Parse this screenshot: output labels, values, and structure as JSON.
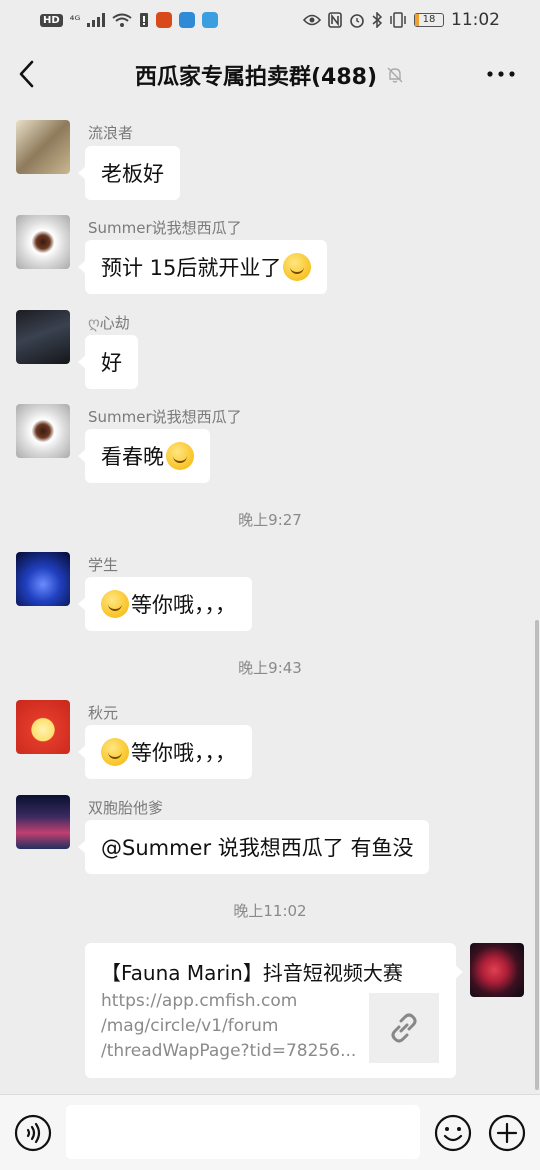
{
  "status_bar": {
    "network_badge": "HD",
    "network_type": "⁴ᴳ",
    "battery": "18",
    "time": "11:02"
  },
  "header": {
    "title": "西瓜家专属拍卖群(488)"
  },
  "messages": [
    {
      "sender": "流浪者",
      "text": "老板好",
      "emoji": ""
    },
    {
      "sender": "Summer说我想西瓜了",
      "text": "预计 15后就开业了",
      "emoji": "grin-emoji"
    },
    {
      "sender": "心劫",
      "text": "好",
      "emoji": ""
    },
    {
      "sender": "Summer说我想西瓜了",
      "text": "看春晚",
      "emoji": "thinking-emoji"
    },
    {
      "sender": "学生",
      "text": "等你哦，，，",
      "emoji": "smile-emoji"
    },
    {
      "sender": "秋元",
      "text": "等你哦，，，",
      "emoji": "smile-emoji"
    },
    {
      "sender": "双胞胎他爹",
      "text": "@Summer 说我想西瓜了  有鱼没",
      "emoji": ""
    }
  ],
  "timestamps": [
    "晚上9:27",
    "晚上9:43",
    "晚上11:02"
  ],
  "link_card": {
    "title": "【Fauna Marin】抖音短视频大赛",
    "url_lines": [
      "https://app.cmfish.com",
      "/mag/circle/v1/forum",
      "/threadWapPage?tid=78256..."
    ],
    "thumb_icon": "link-icon"
  },
  "input": {
    "placeholder": ""
  }
}
